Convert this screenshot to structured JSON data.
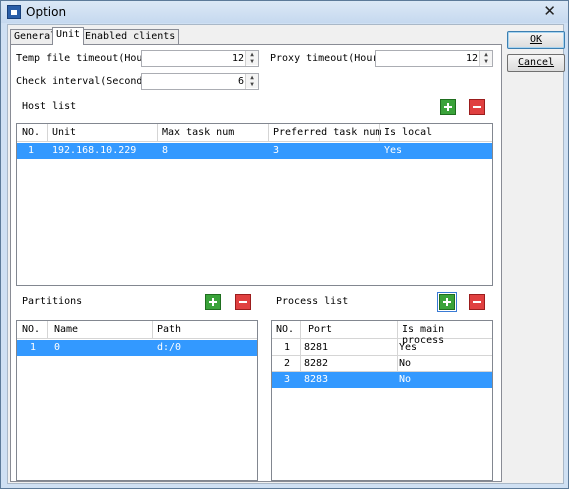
{
  "window": {
    "title": "Option"
  },
  "tabs": [
    "General",
    "Unit",
    "Enabled clients"
  ],
  "settings": {
    "temp_timeout_label": "Temp file timeout(Hour)",
    "temp_timeout_value": "12",
    "proxy_timeout_label": "Proxy timeout(Hour)",
    "proxy_timeout_value": "12",
    "check_interval_label": "Check interval(Second)",
    "check_interval_value": "6"
  },
  "host_list": {
    "label": "Host list",
    "columns": [
      "NO.",
      "Unit",
      "Max task num",
      "Preferred task num",
      "Is local"
    ],
    "rows": [
      {
        "no": "1",
        "unit": "192.168.10.229",
        "max": "8",
        "preferred": "3",
        "local": "Yes",
        "selected": true
      }
    ]
  },
  "partitions": {
    "label": "Partitions",
    "columns": [
      "NO.",
      "Name",
      "Path"
    ],
    "rows": [
      {
        "no": "1",
        "name": "0",
        "path": "d:/0",
        "selected": true
      }
    ]
  },
  "process_list": {
    "label": "Process list",
    "columns": [
      "NO.",
      "Port",
      "Is main process"
    ],
    "rows": [
      {
        "no": "1",
        "port": "8281",
        "main": "Yes",
        "selected": false
      },
      {
        "no": "2",
        "port": "8282",
        "main": "No",
        "selected": false
      },
      {
        "no": "3",
        "port": "8283",
        "main": "No",
        "selected": true
      }
    ]
  },
  "buttons": {
    "ok": "OK",
    "cancel": "Cancel"
  },
  "colors": {
    "selection": "#3399ff",
    "titlebar": "#c6d9ef",
    "add": "#3aa33a",
    "remove": "#e04040"
  }
}
